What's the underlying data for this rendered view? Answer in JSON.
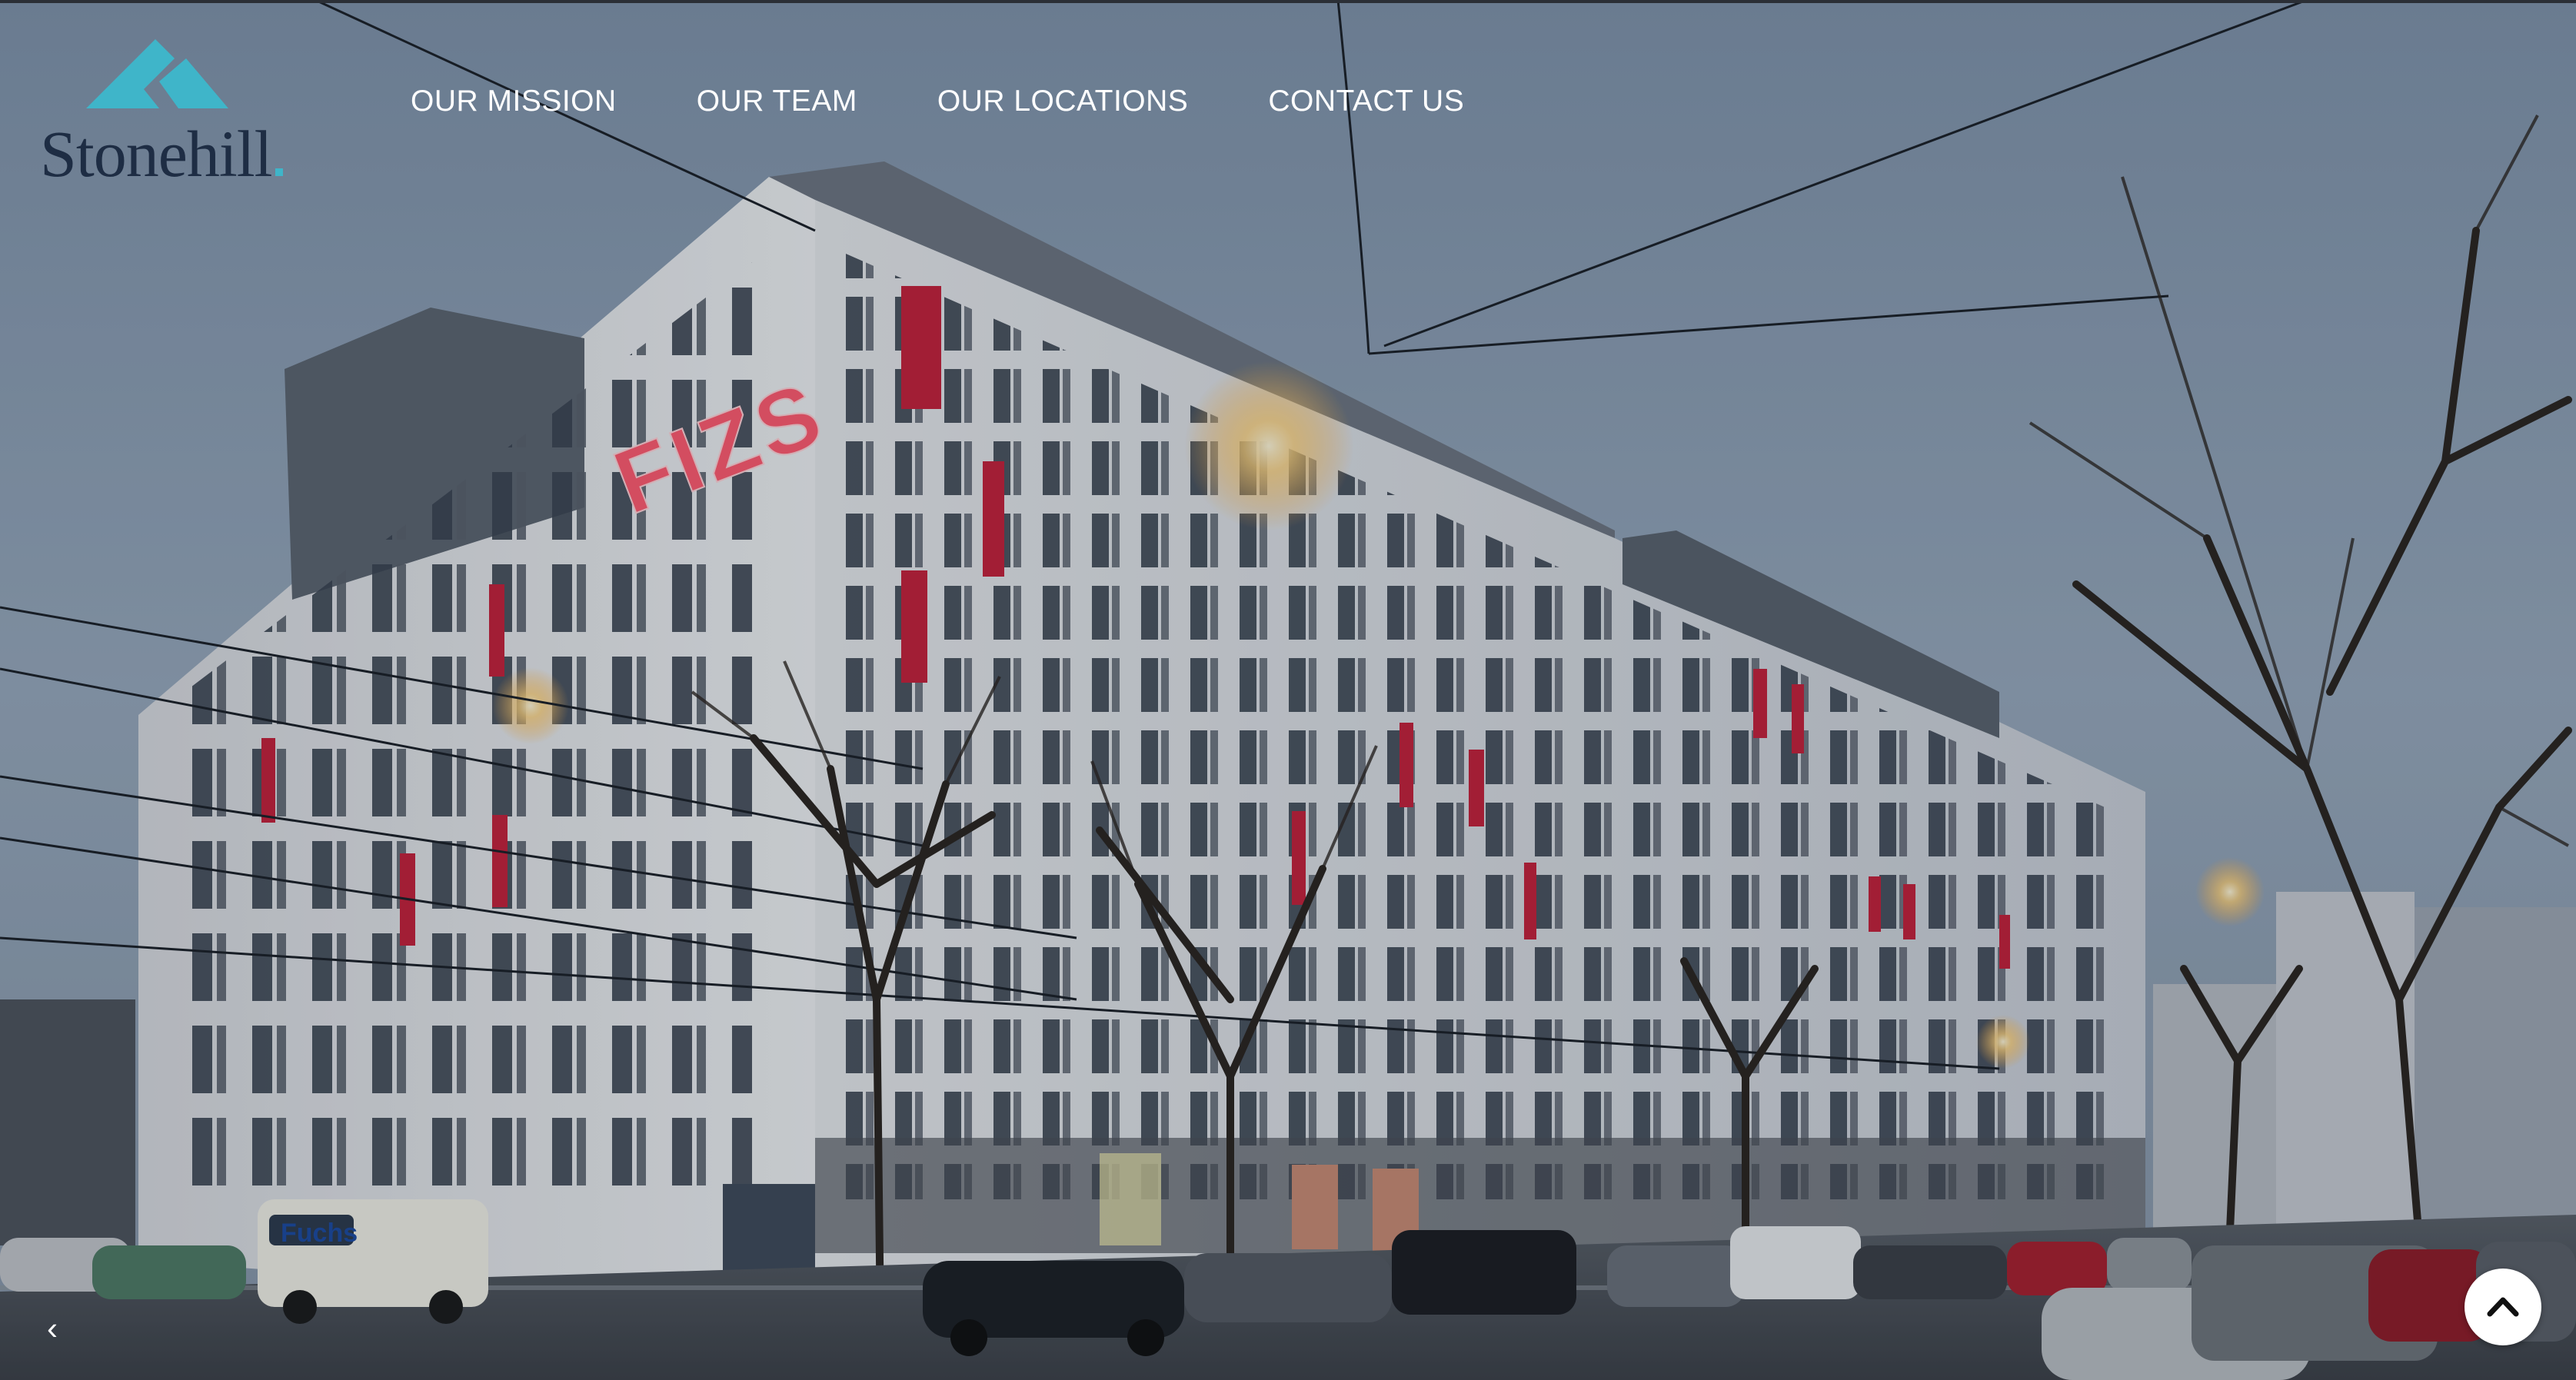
{
  "brand": {
    "name": "Stonehill",
    "colors": {
      "mark": "#3fb5c9",
      "text": "#1e2d44"
    }
  },
  "nav": {
    "items": [
      {
        "label": "OUR MISSION"
      },
      {
        "label": "OUR TEAM"
      },
      {
        "label": "OUR LOCATIONS"
      },
      {
        "label": "CONTACT US"
      }
    ]
  },
  "hero": {
    "building_sign": "FIZS",
    "van_text": "Fuchs"
  },
  "controls": {
    "prev_icon": "chevron-left-icon",
    "scroll_top_icon": "chevron-up-icon",
    "prev_glyph": "‹"
  },
  "colors": {
    "sky_top": "#8a9bb0",
    "sky_bottom": "#a9b6c6",
    "facade": "#e8e9ec",
    "accent_red": "#c4203a",
    "window": "#3a4350"
  }
}
